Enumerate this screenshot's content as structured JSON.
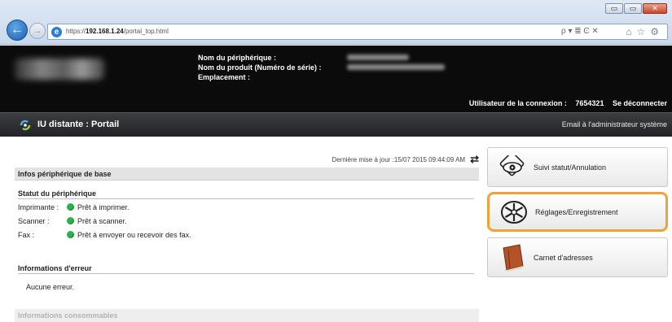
{
  "browser": {
    "url_prefix": "https://",
    "url_host": "192.168.1.24",
    "url_path": "/portal_top.html",
    "toolbar_glyphs": "ρ ▾ ≣ Ͼ ✕",
    "window_buttons": [
      "▭",
      "▭",
      "✕"
    ]
  },
  "header": {
    "device_name_label": "Nom du périphérique :",
    "product_name_label": "Nom du produit (Numéro de série) :",
    "location_label": "Emplacement :",
    "user_label": "Utilisateur de la connexion :",
    "user_id": "7654321",
    "logout": "Se déconnecter"
  },
  "titlebar": {
    "title": "IU distante : Portail",
    "email_admin": "Email à l'administrateur système"
  },
  "main": {
    "last_update": "Dernière mise à jour :15/07 2015 09:44:09 AM",
    "section_basic": "Infos périphérique de base",
    "device_status_title": "Statut du périphérique",
    "status_rows": [
      {
        "label": "Imprimante :",
        "value": "Prêt à imprimer.",
        "status_color": "#2bb24c"
      },
      {
        "label": "Scanner :",
        "value": "Prêt à scanner.",
        "status_color": "#2bb24c"
      },
      {
        "label": "Fax :",
        "value": "Prêt à envoyer ou recevoir des fax.",
        "status_color": "#2bb24c"
      }
    ],
    "error_title": "Informations d'erreur",
    "error_text": "Aucune erreur.",
    "consumables": "Informations consommables"
  },
  "menu": {
    "monitor": "Suivi statut/Annulation",
    "settings": "Réglages/Enregistrement",
    "address_book": "Carnet d'adresses",
    "accent_color": "#f0a13a"
  }
}
